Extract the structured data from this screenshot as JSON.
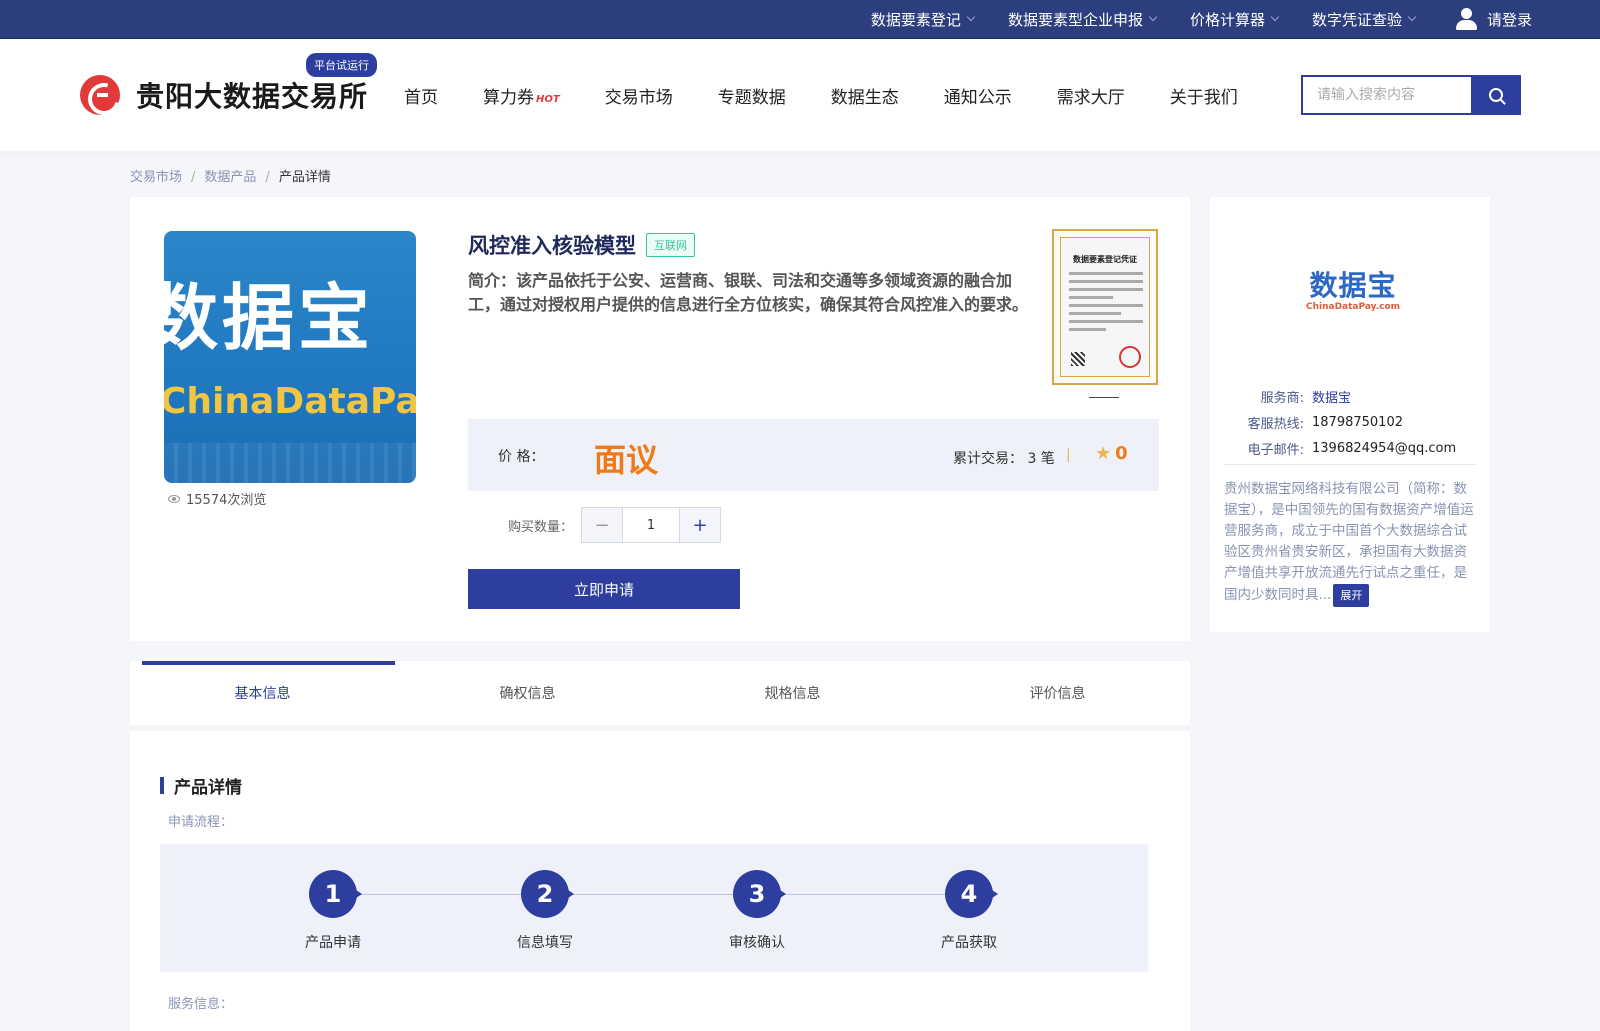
{
  "topbar": {
    "items": [
      "数据要素登记",
      "数据要素型企业申报",
      "价格计算器",
      "数字凭证查验"
    ],
    "login": "请登录"
  },
  "header": {
    "brand": "贵阳大数据交易所",
    "trial_badge": "平台试运行",
    "nav": [
      "首页",
      "算力券",
      "交易市场",
      "专题数据",
      "数据生态",
      "通知公示",
      "需求大厅",
      "关于我们"
    ],
    "hot_label": "HOT",
    "search_placeholder": "请输入搜索内容"
  },
  "breadcrumb": [
    "交易市场",
    "数据产品",
    "产品详情"
  ],
  "product": {
    "image_text_cn": "数据宝",
    "image_text_en": "ChinaDataPay.",
    "views": "15574次浏览",
    "title": "风控准入核验模型",
    "tag": "互联网",
    "intro": "简介：该产品依托于公安、运营商、银联、司法和交通等多领域资源的融合加工，通过对授权用户提供的信息进行全方位核实，确保其符合风控准入的要求。",
    "cert_title": "数据要素登记凭证",
    "price_label": "价 格：",
    "price_value": "面议",
    "trade_count": "累计交易： 3 笔",
    "rating": "0",
    "qty_label": "购买数量：",
    "qty_value": "1",
    "apply_label": "立即申请"
  },
  "provider": {
    "logo_cn": "数据宝",
    "logo_en": "ChinaDataPay.com",
    "service_label": "服务商:",
    "service_value": "数据宝",
    "hotline_label": "客服热线:",
    "hotline_value": "18798750102",
    "email_label": "电子邮件:",
    "email_value": "1396824954@qq.com",
    "description": "贵州数据宝网络科技有限公司（简称：数据宝），是中国领先的国有数据资产增值运营服务商，成立于中国首个大数据综合试验区贵州省贵安新区，承担国有大数据资产增值共享开放流通先行试点之重任，是国内少数同时具...",
    "expand_label": "展开"
  },
  "tabs": [
    "基本信息",
    "确权信息",
    "规格信息",
    "评价信息"
  ],
  "detail": {
    "section_title": "产品详情",
    "flow_label": "申请流程：",
    "steps": [
      {
        "num": "1",
        "label": "产品申请"
      },
      {
        "num": "2",
        "label": "信息填写"
      },
      {
        "num": "3",
        "label": "审核确认"
      },
      {
        "num": "4",
        "label": "产品获取"
      }
    ],
    "service_info_label": "服务信息："
  },
  "colors": {
    "primary": "#2d3e9f",
    "topbar": "#2d3e7f",
    "price": "#f07a18",
    "tag": "#39c3a0",
    "logo_red": "#e23a3a"
  }
}
